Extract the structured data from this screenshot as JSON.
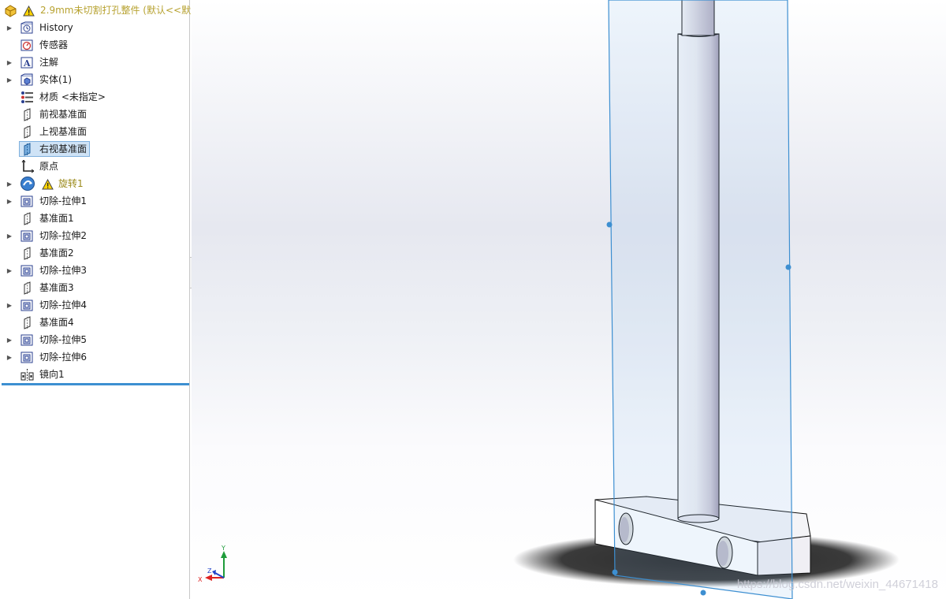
{
  "document": {
    "title": "2.9mm未切割打孔整件 (默认<<默"
  },
  "tree": {
    "items": [
      {
        "label": "History",
        "icon": "history-icon",
        "expandable": true
      },
      {
        "label": "传感器",
        "icon": "sensor-icon",
        "expandable": false
      },
      {
        "label": "注解",
        "icon": "annotation-icon",
        "expandable": true
      },
      {
        "label": "实体(1)",
        "icon": "solid-body-icon",
        "expandable": true
      },
      {
        "label": "材质 <未指定>",
        "icon": "material-icon",
        "expandable": false
      },
      {
        "label": "前视基准面",
        "icon": "plane-icon",
        "expandable": false
      },
      {
        "label": "上视基准面",
        "icon": "plane-icon",
        "expandable": false
      },
      {
        "label": "右视基准面",
        "icon": "plane-icon",
        "expandable": false,
        "selected": true
      },
      {
        "label": "原点",
        "icon": "origin-icon",
        "expandable": false
      },
      {
        "label": "旋转1",
        "icon": "revolve-icon",
        "expandable": true,
        "warning": true
      },
      {
        "label": "切除-拉伸1",
        "icon": "cut-extrude-icon",
        "expandable": true
      },
      {
        "label": "基准面1",
        "icon": "plane-icon",
        "expandable": false
      },
      {
        "label": "切除-拉伸2",
        "icon": "cut-extrude-icon",
        "expandable": true
      },
      {
        "label": "基准面2",
        "icon": "plane-icon",
        "expandable": false
      },
      {
        "label": "切除-拉伸3",
        "icon": "cut-extrude-icon",
        "expandable": true
      },
      {
        "label": "基准面3",
        "icon": "plane-icon",
        "expandable": false
      },
      {
        "label": "切除-拉伸4",
        "icon": "cut-extrude-icon",
        "expandable": true
      },
      {
        "label": "基准面4",
        "icon": "plane-icon",
        "expandable": false
      },
      {
        "label": "切除-拉伸5",
        "icon": "cut-extrude-icon",
        "expandable": true
      },
      {
        "label": "切除-拉伸6",
        "icon": "cut-extrude-icon",
        "expandable": true
      },
      {
        "label": "镜向1",
        "icon": "mirror-icon",
        "expandable": false
      }
    ]
  },
  "triad": {
    "x_label": "X",
    "y_label": "Y",
    "z_label": "Z"
  },
  "watermark": "https://blog.csdn.net/weixin_44671418",
  "colors": {
    "selection": "#cfe3f6",
    "plane_edge": "#3d8fd1",
    "warning": "#e0b300",
    "rollback": "#3d8fd1"
  }
}
